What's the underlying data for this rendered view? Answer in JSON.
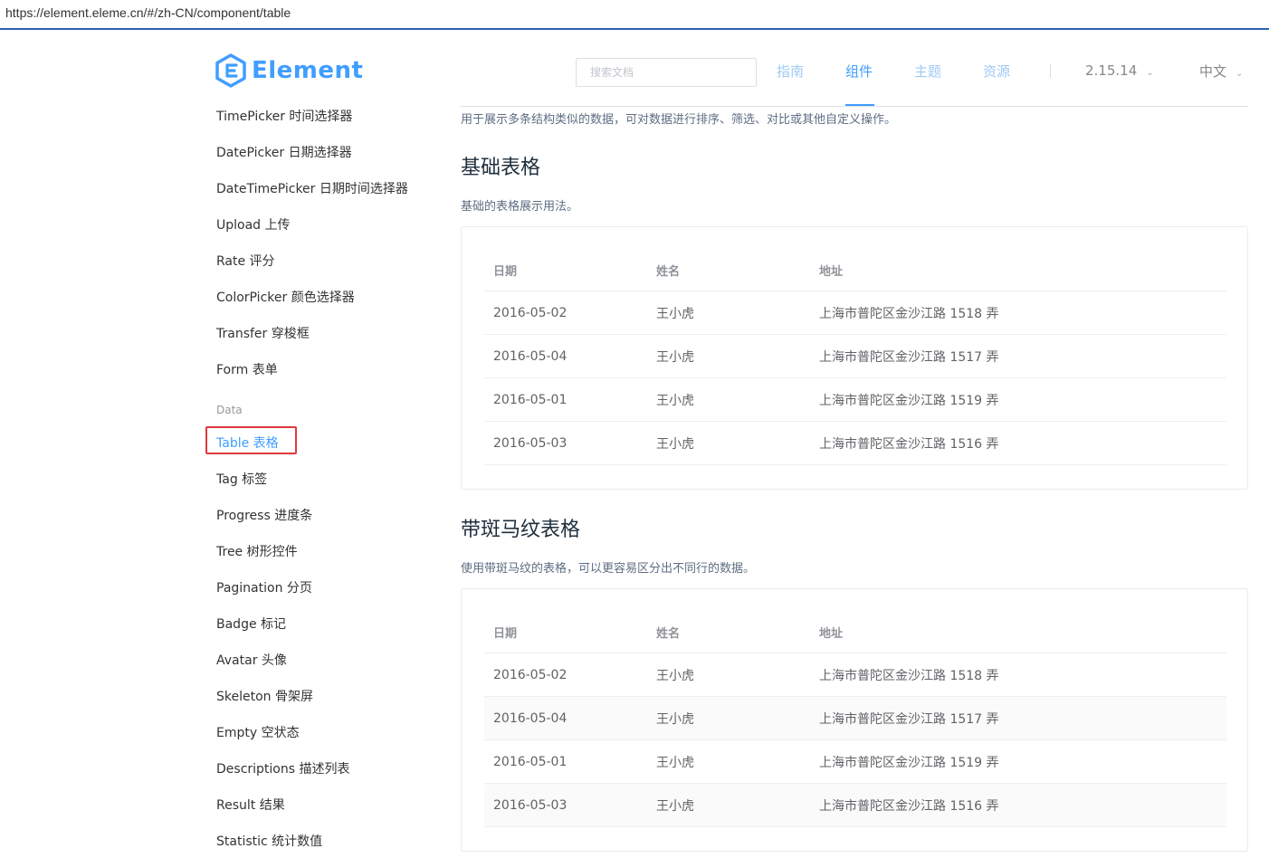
{
  "browser": {
    "url": "https://element.eleme.cn/#/zh-CN/component/table"
  },
  "header": {
    "logo_text": "Element",
    "search_placeholder": "搜索文档",
    "nav": [
      {
        "label": "指南"
      },
      {
        "label": "组件"
      },
      {
        "label": "主题"
      },
      {
        "label": "资源"
      }
    ],
    "active_nav": "组件",
    "version": "2.15.14",
    "language": "中文"
  },
  "colors": {
    "accent": "#409eff",
    "highlight_border": "#e0383e"
  },
  "sidebar": {
    "items_top": [
      "TimePicker 时间选择器",
      "DatePicker 日期选择器",
      "DateTimePicker 日期时间选择器",
      "Upload 上传",
      "Rate 评分",
      "ColorPicker 颜色选择器",
      "Transfer 穿梭框",
      "Form 表单"
    ],
    "group_label": "Data",
    "active_item": "Table 表格",
    "items_bottom": [
      "Tag 标签",
      "Progress 进度条",
      "Tree 树形控件",
      "Pagination 分页",
      "Badge 标记",
      "Avatar 头像",
      "Skeleton 骨架屏",
      "Empty 空状态",
      "Descriptions 描述列表",
      "Result 结果",
      "Statistic 统计数值"
    ]
  },
  "main": {
    "intro": "用于展示多条结构类似的数据，可对数据进行排序、筛选、对比或其他自定义操作。",
    "sections": [
      {
        "title": "基础表格",
        "desc": "基础的表格展示用法。",
        "columns": [
          "日期",
          "姓名",
          "地址"
        ],
        "rows": [
          [
            "2016-05-02",
            "王小虎",
            "上海市普陀区金沙江路 1518 弄"
          ],
          [
            "2016-05-04",
            "王小虎",
            "上海市普陀区金沙江路 1517 弄"
          ],
          [
            "2016-05-01",
            "王小虎",
            "上海市普陀区金沙江路 1519 弄"
          ],
          [
            "2016-05-03",
            "王小虎",
            "上海市普陀区金沙江路 1516 弄"
          ]
        ]
      },
      {
        "title": "带斑马纹表格",
        "desc": "使用带斑马纹的表格，可以更容易区分出不同行的数据。",
        "columns": [
          "日期",
          "姓名",
          "地址"
        ],
        "rows": [
          [
            "2016-05-02",
            "王小虎",
            "上海市普陀区金沙江路 1518 弄"
          ],
          [
            "2016-05-04",
            "王小虎",
            "上海市普陀区金沙江路 1517 弄"
          ],
          [
            "2016-05-01",
            "王小虎",
            "上海市普陀区金沙江路 1519 弄"
          ],
          [
            "2016-05-03",
            "王小虎",
            "上海市普陀区金沙江路 1516 弄"
          ]
        ]
      }
    ]
  }
}
